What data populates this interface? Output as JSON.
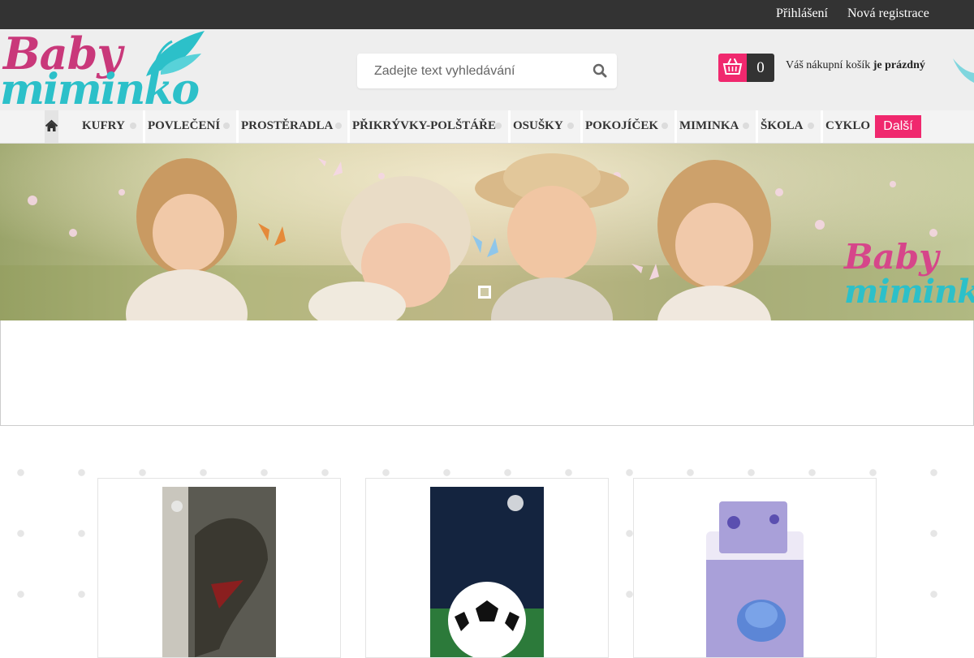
{
  "topbar": {
    "login": "Přihlášení",
    "register": "Nová registrace"
  },
  "logo": {
    "line1": "Baby",
    "line2": "miminko"
  },
  "search": {
    "placeholder": "Zadejte text vyhledávání",
    "icon": "search-icon"
  },
  "cart": {
    "count": "0",
    "text_prefix": "Váš nákupní košík",
    "text_status": "je prázdný",
    "icon": "basket-icon"
  },
  "nav": {
    "home_icon": "home-icon",
    "items": [
      "KUFRY",
      "POVLEČENÍ",
      "PROSTĚRADLA",
      "PŘIKRÝVKY-POLŠTÁŘE",
      "OSUŠKY",
      "POKOJÍČEK",
      "MIMINKA",
      "ŠKOLA",
      "CYKLO"
    ],
    "more": "Další"
  },
  "banner": {
    "logo_line1": "Baby",
    "logo_line2": "miminko"
  },
  "colors": {
    "accent": "#f0286e",
    "brand_pink": "#c9387a",
    "brand_teal": "#2cc0c9",
    "topbar": "#333333"
  }
}
